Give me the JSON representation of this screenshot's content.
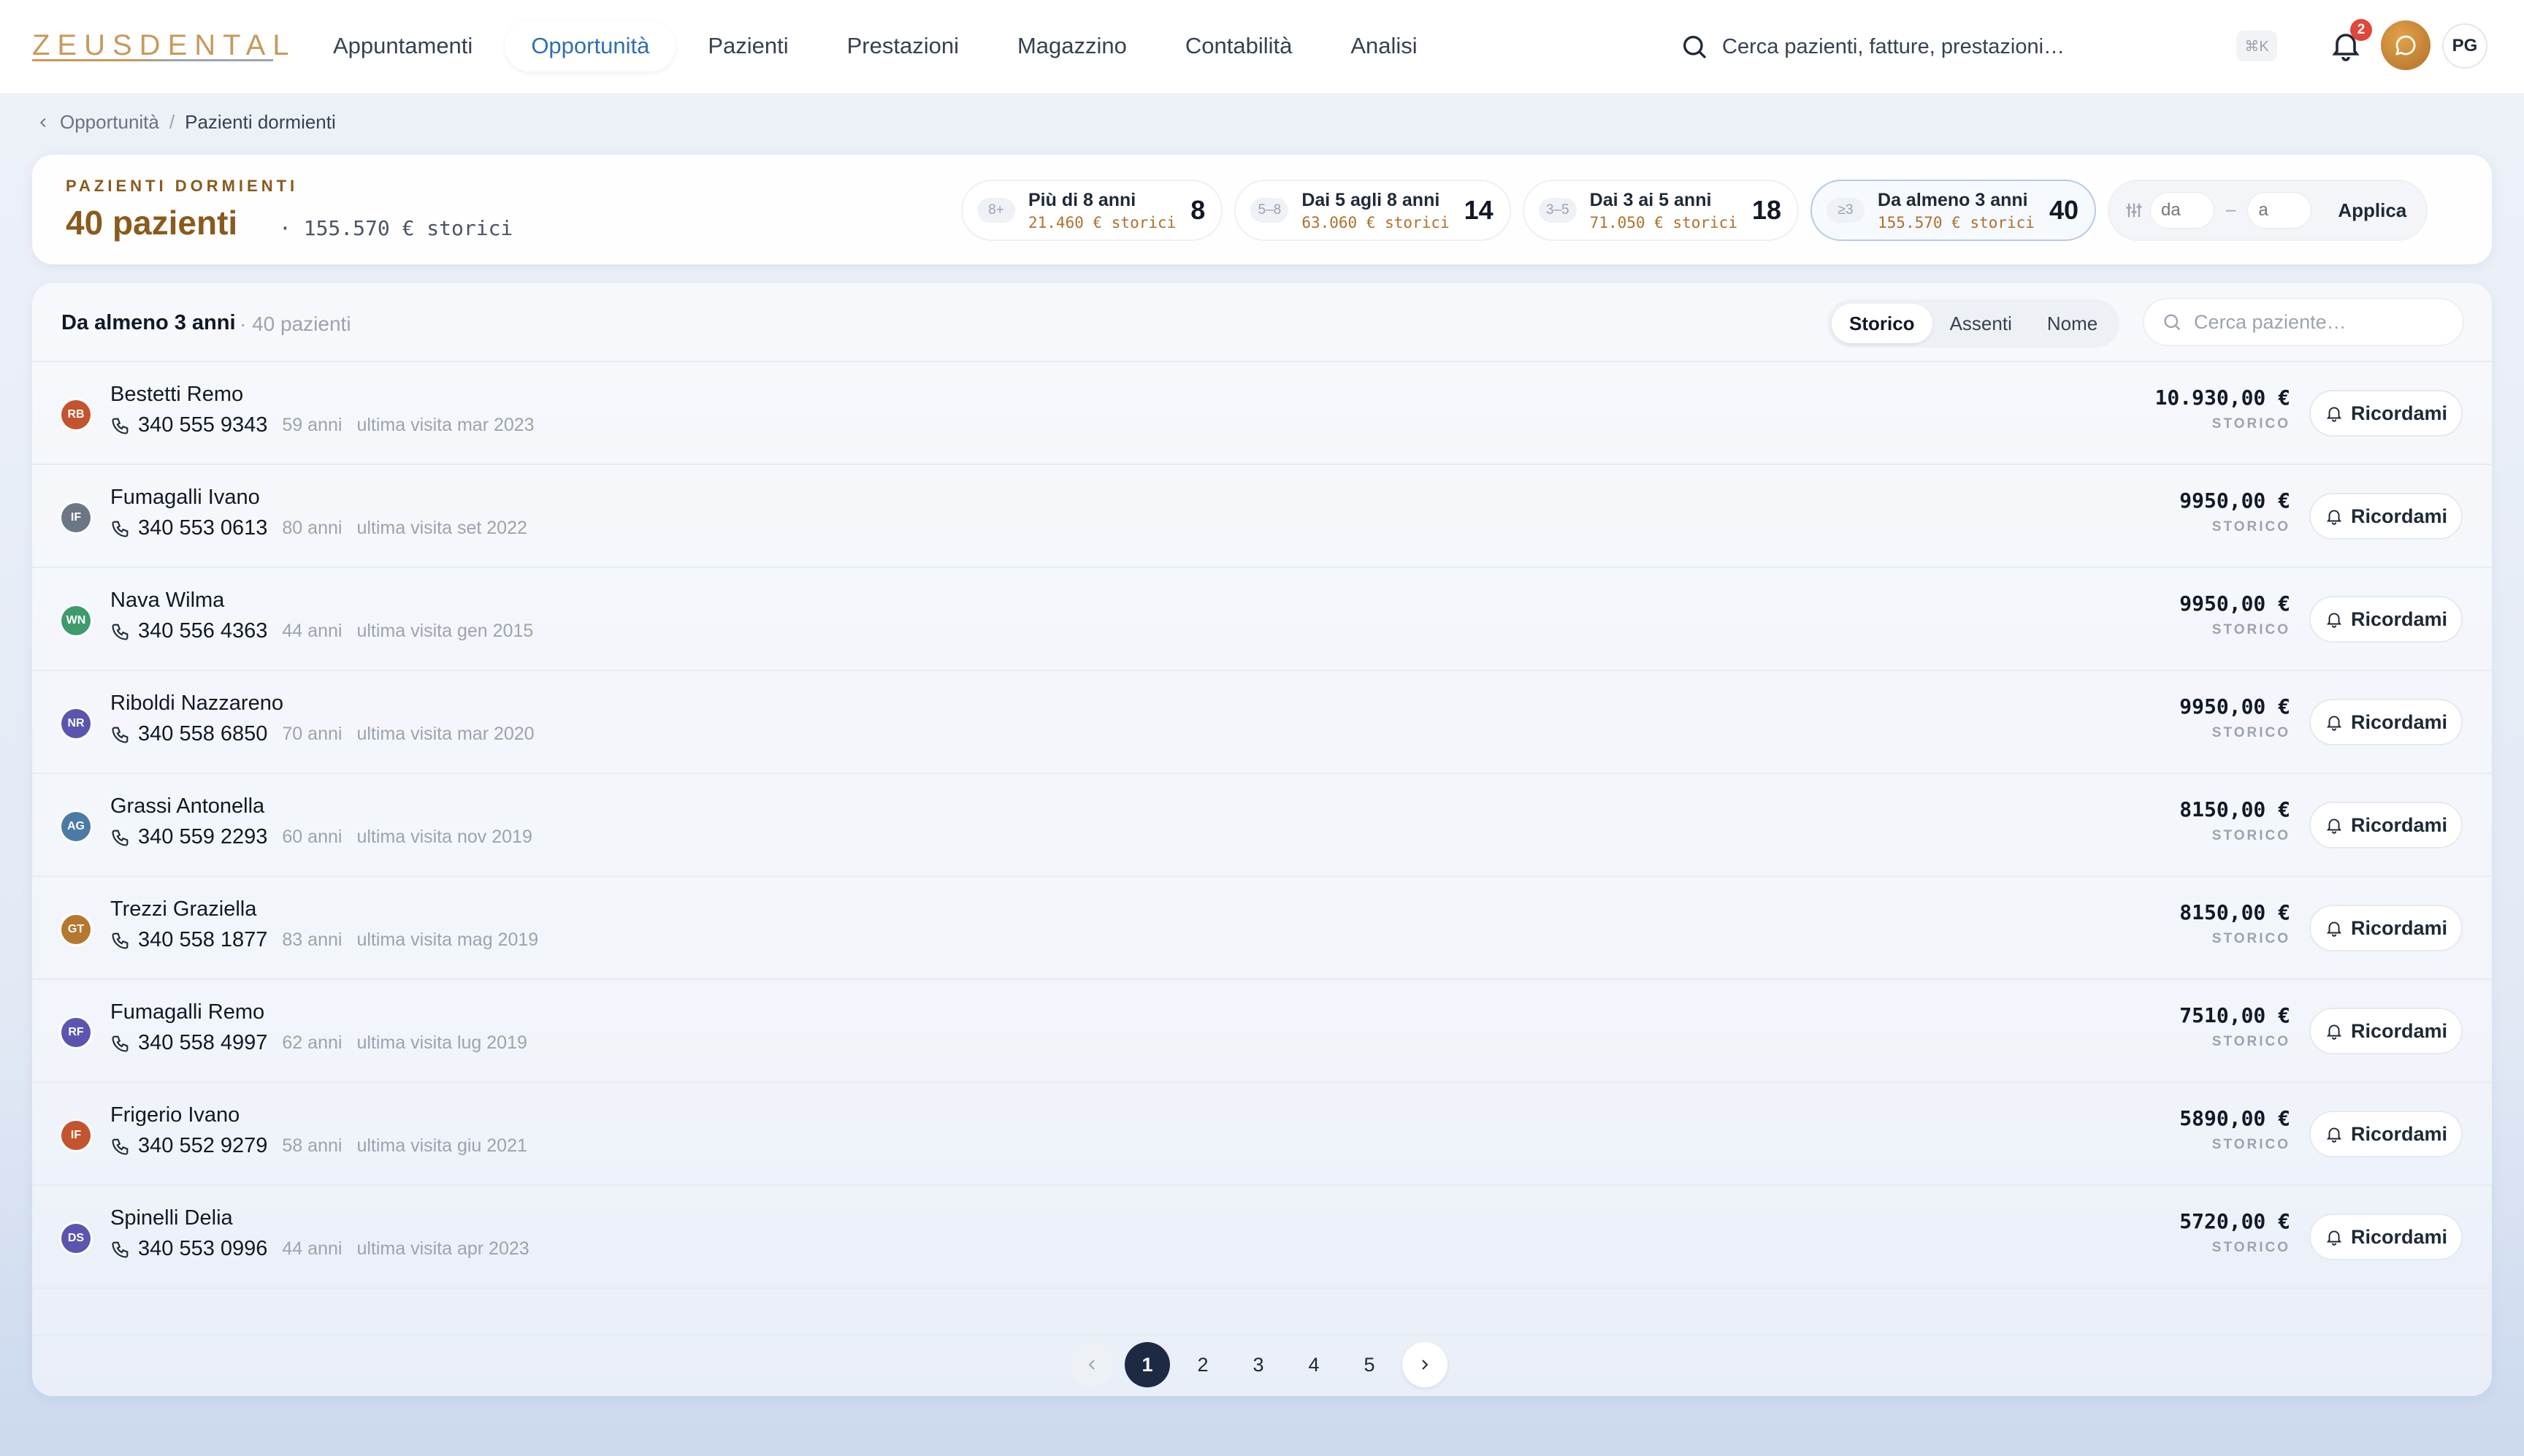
{
  "app": {
    "logo_text": "ZEUSDENTAL"
  },
  "nav": [
    {
      "label": "Appuntamenti",
      "active": false
    },
    {
      "label": "Opportunità",
      "active": true
    },
    {
      "label": "Pazienti",
      "active": false
    },
    {
      "label": "Prestazioni",
      "active": false
    },
    {
      "label": "Magazzino",
      "active": false
    },
    {
      "label": "Contabilità",
      "active": false
    },
    {
      "label": "Analisi",
      "active": false
    }
  ],
  "search": {
    "placeholder": "Cerca pazienti, fatture, prestazioni…",
    "shortcut": "⌘K"
  },
  "notifications": {
    "count": "2"
  },
  "user": {
    "initials": "PG"
  },
  "breadcrumb": {
    "parent": "Opportunità",
    "separator": "/",
    "current": "Pazienti dormienti"
  },
  "summary": {
    "eyebrow": "PAZIENTI DORMIENTI",
    "count": "40 pazienti",
    "historic": "· 155.570 € storici"
  },
  "filters": [
    {
      "tag": "8+",
      "label": "Più di 8 anni",
      "sub": "21.460 € storici",
      "count": "8",
      "active": false
    },
    {
      "tag": "5–8",
      "label": "Dai 5 agli 8 anni",
      "sub": "63.060 € storici",
      "count": "14",
      "active": false
    },
    {
      "tag": "3–5",
      "label": "Dai 3 ai 5 anni",
      "sub": "71.050 € storici",
      "count": "18",
      "active": false
    },
    {
      "tag": "≥3",
      "label": "Da almeno 3 anni",
      "sub": "155.570 € storici",
      "count": "40",
      "active": true
    }
  ],
  "range": {
    "from_placeholder": "da",
    "dash": "–",
    "to_placeholder": "a",
    "apply_label": "Applica"
  },
  "list": {
    "title": "Da almeno 3 anni",
    "subtitle": "· 40 pazienti",
    "sort_options": [
      "Storico",
      "Assenti",
      "Nome"
    ],
    "sort_selected": "Storico",
    "search_placeholder": "Cerca paziente…",
    "amount_label": "STORICO",
    "remind_label": "Ricordami"
  },
  "colors": {
    "accent": "#2f6fb1",
    "brand": "#8a5a1c",
    "gold": "#b0702a",
    "dark": "#1e2a44"
  },
  "patients": [
    {
      "initials": "RB",
      "color": "#c4532f",
      "name": "Bestetti Remo",
      "phone": "340 555 9343",
      "age": "59 anni",
      "visit": "ultima visita mar 2023",
      "amount": "10.930,00 €"
    },
    {
      "initials": "IF",
      "color": "#6b7787",
      "name": "Fumagalli Ivano",
      "phone": "340 553 0613",
      "age": "80 anni",
      "visit": "ultima visita set 2022",
      "amount": "9950,00 €"
    },
    {
      "initials": "WN",
      "color": "#3f9b6c",
      "name": "Nava Wilma",
      "phone": "340 556 4363",
      "age": "44 anni",
      "visit": "ultima visita gen 2015",
      "amount": "9950,00 €"
    },
    {
      "initials": "NR",
      "color": "#5b55b0",
      "name": "Riboldi Nazzareno",
      "phone": "340 558 6850",
      "age": "70 anni",
      "visit": "ultima visita mar 2020",
      "amount": "9950,00 €"
    },
    {
      "initials": "AG",
      "color": "#4b7aa6",
      "name": "Grassi Antonella",
      "phone": "340 559 2293",
      "age": "60 anni",
      "visit": "ultima visita nov 2019",
      "amount": "8150,00 €"
    },
    {
      "initials": "GT",
      "color": "#b5782e",
      "name": "Trezzi Graziella",
      "phone": "340 558 1877",
      "age": "83 anni",
      "visit": "ultima visita mag 2019",
      "amount": "8150,00 €"
    },
    {
      "initials": "RF",
      "color": "#5b55b0",
      "name": "Fumagalli Remo",
      "phone": "340 558 4997",
      "age": "62 anni",
      "visit": "ultima visita lug 2019",
      "amount": "7510,00 €"
    },
    {
      "initials": "IF",
      "color": "#c4532f",
      "name": "Frigerio Ivano",
      "phone": "340 552 9279",
      "age": "58 anni",
      "visit": "ultima visita giu 2021",
      "amount": "5890,00 €"
    },
    {
      "initials": "DS",
      "color": "#5b55b0",
      "name": "Spinelli Delia",
      "phone": "340 553 0996",
      "age": "44 anni",
      "visit": "ultima visita apr 2023",
      "amount": "5720,00 €"
    }
  ],
  "pagination": {
    "pages": [
      "1",
      "2",
      "3",
      "4",
      "5"
    ],
    "current": "1"
  }
}
